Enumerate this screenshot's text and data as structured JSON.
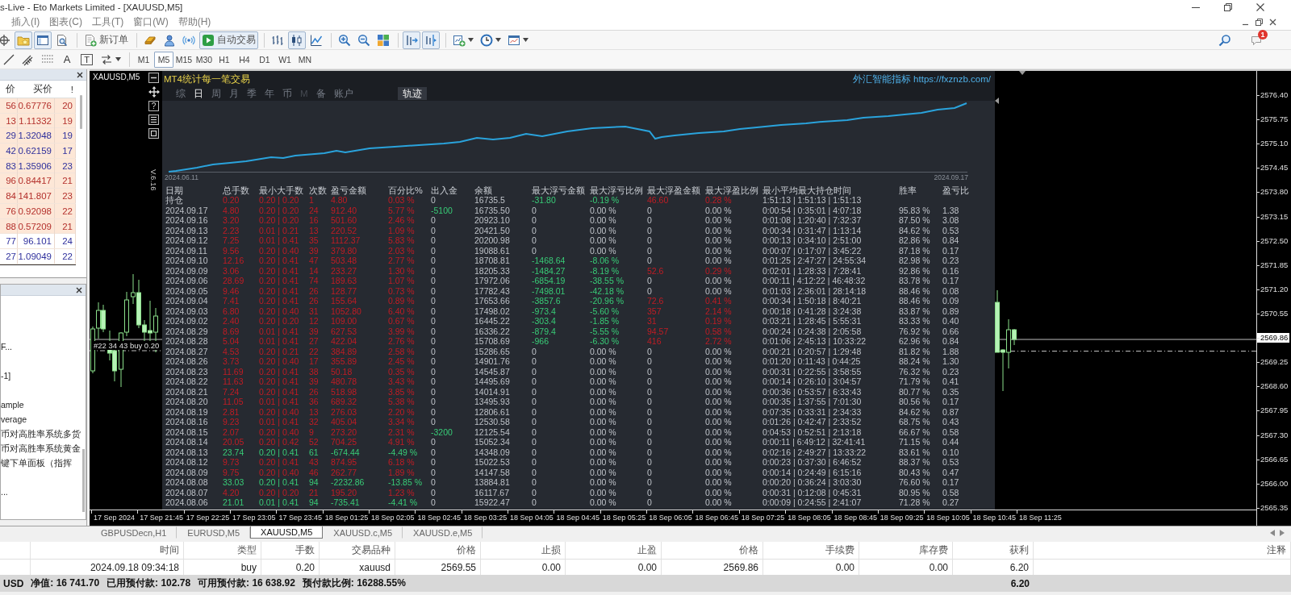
{
  "window": {
    "title": "s-Live - Eto Markets Limited - [XAUUSD,M5]"
  },
  "menu": [
    "插入(I)",
    "图表(C)",
    "工具(T)",
    "窗口(W)",
    "帮助(H)"
  ],
  "toolbar": {
    "panel_toggles": [
      {
        "on": true
      },
      {
        "on": true
      },
      {
        "on": false
      }
    ],
    "new_order": "新订单",
    "auto_trading": {
      "label": "自动交易",
      "on": true
    },
    "chart_types": [
      {
        "selected": false
      },
      {
        "selected": true
      },
      {
        "selected": false
      }
    ],
    "auto_scroll": {
      "on": true
    },
    "chart_shift": {
      "on": true
    },
    "notification_badge": "1"
  },
  "drawing_toolbar": {
    "text_tool": "A",
    "text_label_tool": "T",
    "timeframes": [
      {
        "label": "M1",
        "selected": false
      },
      {
        "label": "M5",
        "selected": true
      },
      {
        "label": "M15",
        "selected": false
      },
      {
        "label": "M30",
        "selected": false
      },
      {
        "label": "H1",
        "selected": false
      },
      {
        "label": "H4",
        "selected": false
      },
      {
        "label": "D1",
        "selected": false
      },
      {
        "label": "W1",
        "selected": false
      },
      {
        "label": "MN",
        "selected": false
      }
    ]
  },
  "market_watch": {
    "columns": [
      "价",
      "买价",
      "!"
    ],
    "rows": [
      {
        "column_1": "56",
        "ask": "0.67776",
        "column_3": "20",
        "rising": false,
        "highlighted": true
      },
      {
        "column_1": "13",
        "ask": "1.11332",
        "column_3": "19",
        "rising": false,
        "highlighted": true
      },
      {
        "column_1": "29",
        "ask": "1.32048",
        "column_3": "19",
        "rising": true,
        "highlighted": true
      },
      {
        "column_1": "42",
        "ask": "0.62159",
        "column_3": "17",
        "rising": true,
        "highlighted": true
      },
      {
        "column_1": "83",
        "ask": "1.35906",
        "column_3": "23",
        "rising": true,
        "highlighted": true
      },
      {
        "column_1": "96",
        "ask": "0.84417",
        "column_3": "21",
        "rising": false,
        "highlighted": true
      },
      {
        "column_1": "84",
        "ask": "141.807",
        "column_3": "23",
        "rising": false,
        "highlighted": true
      },
      {
        "column_1": "76",
        "ask": "0.92098",
        "column_3": "22",
        "rising": false,
        "highlighted": true
      },
      {
        "column_1": "88",
        "ask": "0.57209",
        "column_3": "21",
        "rising": false,
        "highlighted": true
      },
      {
        "column_1": "77",
        "ask": "96.101",
        "column_3": "24",
        "rising": true,
        "highlighted": false
      },
      {
        "column_1": "27",
        "ask": "1.09049",
        "column_3": "22",
        "rising": true,
        "highlighted": false
      }
    ]
  },
  "navigator": {
    "items": [
      "F...",
      "-1]",
      "ample",
      "verage",
      "币对高胜率系统多货",
      "币对高胜率系统黄金",
      "键下单面板（指挥",
      "..."
    ]
  },
  "chart": {
    "symbol": "XAUUSD,M5",
    "help_button": "?",
    "version": "V.6.16",
    "order_label": "#22 34 43 buy 0.20",
    "price_axis": [
      {
        "label": "2576.40",
        "kind": "tick"
      },
      {
        "label": "2575.75",
        "kind": "tick"
      },
      {
        "label": "2575.10",
        "kind": "tick"
      },
      {
        "label": "2574.45",
        "kind": "tick"
      },
      {
        "label": "2573.80",
        "kind": "tick"
      },
      {
        "label": "2573.15",
        "kind": "tick"
      },
      {
        "label": "2572.50",
        "kind": "tick"
      },
      {
        "label": "2571.85",
        "kind": "tick"
      },
      {
        "label": "2571.20",
        "kind": "tick"
      },
      {
        "label": "2570.55",
        "kind": "tick"
      },
      {
        "label": "2569.86",
        "kind": "current"
      },
      {
        "label": "2569.25",
        "kind": "tick"
      },
      {
        "label": "2568.60",
        "kind": "tick"
      },
      {
        "label": "2567.95",
        "kind": "tick"
      },
      {
        "label": "2567.30",
        "kind": "tick"
      },
      {
        "label": "2566.65",
        "kind": "tick"
      },
      {
        "label": "2566.00",
        "kind": "tick"
      },
      {
        "label": "2565.35",
        "kind": "tick"
      }
    ],
    "time_axis": [
      "17 Sep 2024",
      "17 Sep 21:45",
      "17 Sep 22:25",
      "17 Sep 23:05",
      "17 Sep 23:45",
      "18 Sep 01:25",
      "18 Sep 02:05",
      "18 Sep 02:45",
      "18 Sep 03:25",
      "18 Sep 04:05",
      "18 Sep 04:45",
      "18 Sep 05:25",
      "18 Sep 06:05",
      "18 Sep 06:45",
      "18 Sep 07:25",
      "18 Sep 08:05",
      "18 Sep 08:45",
      "18 Sep 09:25",
      "18 Sep 10:05",
      "18 Sep 10:45",
      "18 Sep 11:25"
    ]
  },
  "indicator": {
    "title": "MT4统计每一笔交易",
    "link": "外汇智能指标 https://fxznzb.com/",
    "tabs": [
      {
        "label": "综",
        "selected": false,
        "disabled": false
      },
      {
        "label": "日",
        "selected": true,
        "disabled": false
      },
      {
        "label": "周",
        "selected": false,
        "disabled": false
      },
      {
        "label": "月",
        "selected": false,
        "disabled": false
      },
      {
        "label": "季",
        "selected": false,
        "disabled": false
      },
      {
        "label": "年",
        "selected": false,
        "disabled": false
      },
      {
        "label": "币",
        "selected": false,
        "disabled": false
      },
      {
        "label": "M",
        "selected": false,
        "disabled": true
      },
      {
        "label": "备",
        "selected": false,
        "disabled": false
      },
      {
        "label": "账户",
        "selected": false,
        "disabled": false
      }
    ],
    "track_toggle": {
      "label": "轨迹",
      "on": true
    },
    "equity_curve": {
      "start_date": "2024.06.11",
      "end_date": "2024.09.17"
    },
    "table": {
      "columns": [
        "日期",
        "总手数",
        "最小大手数",
        "次数",
        "盈亏金额",
        "百分比%",
        "出入金",
        "余额",
        "最大浮亏金额",
        "最大浮亏比例",
        "最大浮盈金额",
        "最大浮盈比例",
        "最小平均最大持仓时间",
        "胜率",
        "盈亏比"
      ],
      "rows": [
        {
          "date": "持仓",
          "total_lots": "0.20",
          "min_max_lots": "0.20 | 0.20",
          "trades": "1",
          "profit": "4.80",
          "percent": "0.03 %",
          "deposit": "0",
          "balance": "16735.5",
          "max_float_loss": "-31.80",
          "max_float_loss_pct": "-0.19 %",
          "max_float_profit": "46.60",
          "max_float_profit_pct": "0.28 %",
          "hold_time": "1:51:13 | 1:51:13 | 1:51:13",
          "loss": false,
          "withdrawal": false,
          "floating_loss": true,
          "floating_profit": true
        },
        {
          "date": "2024.09.17",
          "total_lots": "4.80",
          "min_max_lots": "0.20 | 0.20",
          "trades": "24",
          "profit": "912.40",
          "percent": "5.77 %",
          "deposit": "-5100",
          "balance": "16735.50",
          "max_float_loss": "0",
          "max_float_loss_pct": "0.00 %",
          "max_float_profit": "0",
          "max_float_profit_pct": "0.00 %",
          "hold_time": "0:00:54 | 0:35:01 | 4:07:18",
          "win_rate": "95.83 %",
          "profit_ratio": "1.38",
          "loss": false,
          "withdrawal": true,
          "floating_loss": false,
          "floating_profit": false
        },
        {
          "date": "2024.09.16",
          "total_lots": "3.20",
          "min_max_lots": "0.20 | 0.20",
          "trades": "16",
          "profit": "501.60",
          "percent": "2.46 %",
          "deposit": "0",
          "balance": "20923.10",
          "max_float_loss": "0",
          "max_float_loss_pct": "0.00 %",
          "max_float_profit": "0",
          "max_float_profit_pct": "0.00 %",
          "hold_time": "0:01:08 | 1:20:40 | 7:32:37",
          "win_rate": "87.50 %",
          "profit_ratio": "3.08",
          "loss": false,
          "withdrawal": false,
          "floating_loss": false,
          "floating_profit": false
        },
        {
          "date": "2024.09.13",
          "total_lots": "2.23",
          "min_max_lots": "0.01 | 0.21",
          "trades": "13",
          "profit": "220.52",
          "percent": "1.09 %",
          "deposit": "0",
          "balance": "20421.50",
          "max_float_loss": "0",
          "max_float_loss_pct": "0.00 %",
          "max_float_profit": "0",
          "max_float_profit_pct": "0.00 %",
          "hold_time": "0:00:34 | 0:31:47 | 1:13:14",
          "win_rate": "84.62 %",
          "profit_ratio": "0.53",
          "loss": false,
          "withdrawal": false,
          "floating_loss": false,
          "floating_profit": false
        },
        {
          "date": "2024.09.12",
          "total_lots": "7.25",
          "min_max_lots": "0.01 | 0.41",
          "trades": "35",
          "profit": "1112.37",
          "percent": "5.83 %",
          "deposit": "0",
          "balance": "20200.98",
          "max_float_loss": "0",
          "max_float_loss_pct": "0.00 %",
          "max_float_profit": "0",
          "max_float_profit_pct": "0.00 %",
          "hold_time": "0:00:13 | 0:34:10 | 2:51:00",
          "win_rate": "82.86 %",
          "profit_ratio": "0.84",
          "loss": false,
          "withdrawal": false,
          "floating_loss": false,
          "floating_profit": false
        },
        {
          "date": "2024.09.11",
          "total_lots": "9.56",
          "min_max_lots": "0.20 | 0.40",
          "trades": "39",
          "profit": "379.80",
          "percent": "2.03 %",
          "deposit": "0",
          "balance": "19088.61",
          "max_float_loss": "0",
          "max_float_loss_pct": "0.00 %",
          "max_float_profit": "0",
          "max_float_profit_pct": "0.00 %",
          "hold_time": "0:00:07 | 0:17:07 | 3:45:22",
          "win_rate": "87.18 %",
          "profit_ratio": "0.17",
          "loss": false,
          "withdrawal": false,
          "floating_loss": false,
          "floating_profit": false
        },
        {
          "date": "2024.09.10",
          "total_lots": "12.16",
          "min_max_lots": "0.20 | 0.41",
          "trades": "47",
          "profit": "503.48",
          "percent": "2.77 %",
          "deposit": "0",
          "balance": "18708.81",
          "max_float_loss": "-1468.64",
          "max_float_loss_pct": "-8.06 %",
          "max_float_profit": "0",
          "max_float_profit_pct": "0.00 %",
          "hold_time": "0:01:25 | 2:47:27 | 24:55:34",
          "win_rate": "82.98 %",
          "profit_ratio": "0.23",
          "loss": false,
          "withdrawal": false,
          "floating_loss": true,
          "floating_profit": false
        },
        {
          "date": "2024.09.09",
          "total_lots": "3.06",
          "min_max_lots": "0.20 | 0.41",
          "trades": "14",
          "profit": "233.27",
          "percent": "1.30 %",
          "deposit": "0",
          "balance": "18205.33",
          "max_float_loss": "-1484.27",
          "max_float_loss_pct": "-8.19 %",
          "max_float_profit": "52.6",
          "max_float_profit_pct": "0.29 %",
          "hold_time": "0:02:01 | 1:28:33 | 7:28:41",
          "win_rate": "92.86 %",
          "profit_ratio": "0.16",
          "loss": false,
          "withdrawal": false,
          "floating_loss": true,
          "floating_profit": true
        },
        {
          "date": "2024.09.06",
          "total_lots": "28.69",
          "min_max_lots": "0.20 | 0.41",
          "trades": "74",
          "profit": "189.63",
          "percent": "1.07 %",
          "deposit": "0",
          "balance": "17972.06",
          "max_float_loss": "-6854.19",
          "max_float_loss_pct": "-38.55 %",
          "max_float_profit": "0",
          "max_float_profit_pct": "0.00 %",
          "hold_time": "0:00:11 | 4:12:22 | 46:48:32",
          "win_rate": "83.78 %",
          "profit_ratio": "0.17",
          "loss": false,
          "withdrawal": false,
          "floating_loss": true,
          "floating_profit": false
        },
        {
          "date": "2024.09.05",
          "total_lots": "9.46",
          "min_max_lots": "0.20 | 0.41",
          "trades": "26",
          "profit": "128.77",
          "percent": "0.73 %",
          "deposit": "0",
          "balance": "17782.43",
          "max_float_loss": "-7498.01",
          "max_float_loss_pct": "-42.18 %",
          "max_float_profit": "0",
          "max_float_profit_pct": "0.00 %",
          "hold_time": "0:01:03 | 2:36:01 | 28:14:18",
          "win_rate": "88.46 %",
          "profit_ratio": "0.08",
          "loss": false,
          "withdrawal": false,
          "floating_loss": true,
          "floating_profit": false
        },
        {
          "date": "2024.09.04",
          "total_lots": "7.41",
          "min_max_lots": "0.20 | 0.41",
          "trades": "26",
          "profit": "155.64",
          "percent": "0.89 %",
          "deposit": "0",
          "balance": "17653.66",
          "max_float_loss": "-3857.6",
          "max_float_loss_pct": "-20.96 %",
          "max_float_profit": "72.6",
          "max_float_profit_pct": "0.41 %",
          "hold_time": "0:00:34 | 1:50:18 | 8:40:21",
          "win_rate": "88.46 %",
          "profit_ratio": "0.09",
          "loss": false,
          "withdrawal": false,
          "floating_loss": true,
          "floating_profit": true
        },
        {
          "date": "2024.09.03",
          "total_lots": "6.80",
          "min_max_lots": "0.20 | 0.40",
          "trades": "31",
          "profit": "1052.80",
          "percent": "6.40 %",
          "deposit": "0",
          "balance": "17498.02",
          "max_float_loss": "-973.4",
          "max_float_loss_pct": "-5.60 %",
          "max_float_profit": "357",
          "max_float_profit_pct": "2.14 %",
          "hold_time": "0:00:18 | 0:41:28 | 3:24:38",
          "win_rate": "83.87 %",
          "profit_ratio": "0.89",
          "loss": false,
          "withdrawal": false,
          "floating_loss": true,
          "floating_profit": true
        },
        {
          "date": "2024.09.02",
          "total_lots": "2.40",
          "min_max_lots": "0.20 | 0.20",
          "trades": "12",
          "profit": "109.00",
          "percent": "0.67 %",
          "deposit": "0",
          "balance": "16445.22",
          "max_float_loss": "-303.4",
          "max_float_loss_pct": "-1.85 %",
          "max_float_profit": "31",
          "max_float_profit_pct": "0.19 %",
          "hold_time": "0:03:21 | 1:28:45 | 5:55:31",
          "win_rate": "83.33 %",
          "profit_ratio": "0.40",
          "loss": false,
          "withdrawal": false,
          "floating_loss": true,
          "floating_profit": true
        },
        {
          "date": "2024.08.29",
          "total_lots": "8.69",
          "min_max_lots": "0.01 | 0.41",
          "trades": "39",
          "profit": "627.53",
          "percent": "3.99 %",
          "deposit": "0",
          "balance": "16336.22",
          "max_float_loss": "-879.4",
          "max_float_loss_pct": "-5.55 %",
          "max_float_profit": "94.57",
          "max_float_profit_pct": "0.58 %",
          "hold_time": "0:00:24 | 0:24:38 | 2:05:58",
          "win_rate": "76.92 %",
          "profit_ratio": "0.66",
          "loss": false,
          "withdrawal": false,
          "floating_loss": true,
          "floating_profit": true
        },
        {
          "date": "2024.08.28",
          "total_lots": "5.04",
          "min_max_lots": "0.01 | 0.41",
          "trades": "27",
          "profit": "422.04",
          "percent": "2.76 %",
          "deposit": "0",
          "balance": "15708.69",
          "max_float_loss": "-966",
          "max_float_loss_pct": "-6.30 %",
          "max_float_profit": "416",
          "max_float_profit_pct": "2.72 %",
          "hold_time": "0:01:06 | 2:45:13 | 10:33:22",
          "win_rate": "62.96 %",
          "profit_ratio": "0.84",
          "loss": false,
          "withdrawal": false,
          "floating_loss": true,
          "floating_profit": true
        },
        {
          "date": "2024.08.27",
          "total_lots": "4.53",
          "min_max_lots": "0.20 | 0.21",
          "trades": "22",
          "profit": "384.89",
          "percent": "2.58 %",
          "deposit": "0",
          "balance": "15286.65",
          "max_float_loss": "0",
          "max_float_loss_pct": "0.00 %",
          "max_float_profit": "0",
          "max_float_profit_pct": "0.00 %",
          "hold_time": "0:00:21 | 0:20:57 | 1:29:48",
          "win_rate": "81.82 %",
          "profit_ratio": "1.88",
          "loss": false,
          "withdrawal": false,
          "floating_loss": false,
          "floating_profit": false
        },
        {
          "date": "2024.08.26",
          "total_lots": "3.73",
          "min_max_lots": "0.20 | 0.40",
          "trades": "17",
          "profit": "355.89",
          "percent": "2.45 %",
          "deposit": "0",
          "balance": "14901.76",
          "max_float_loss": "0",
          "max_float_loss_pct": "0.00 %",
          "max_float_profit": "0",
          "max_float_profit_pct": "0.00 %",
          "hold_time": "0:01:20 | 0:11:43 | 0:44:25",
          "win_rate": "88.24 %",
          "profit_ratio": "1.30",
          "loss": false,
          "withdrawal": false,
          "floating_loss": false,
          "floating_profit": false
        },
        {
          "date": "2024.08.23",
          "total_lots": "11.69",
          "min_max_lots": "0.20 | 0.41",
          "trades": "38",
          "profit": "50.18",
          "percent": "0.35 %",
          "deposit": "0",
          "balance": "14545.87",
          "max_float_loss": "0",
          "max_float_loss_pct": "0.00 %",
          "max_float_profit": "0",
          "max_float_profit_pct": "0.00 %",
          "hold_time": "0:00:31 | 0:22:55 | 3:58:55",
          "win_rate": "76.32 %",
          "profit_ratio": "0.23",
          "loss": false,
          "withdrawal": false,
          "floating_loss": false,
          "floating_profit": false
        },
        {
          "date": "2024.08.22",
          "total_lots": "11.63",
          "min_max_lots": "0.20 | 0.41",
          "trades": "39",
          "profit": "480.78",
          "percent": "3.43 %",
          "deposit": "0",
          "balance": "14495.69",
          "max_float_loss": "0",
          "max_float_loss_pct": "0.00 %",
          "max_float_profit": "0",
          "max_float_profit_pct": "0.00 %",
          "hold_time": "0:00:14 | 0:26:10 | 3:04:57",
          "win_rate": "71.79 %",
          "profit_ratio": "0.41",
          "loss": false,
          "withdrawal": false,
          "floating_loss": false,
          "floating_profit": false
        },
        {
          "date": "2024.08.21",
          "total_lots": "7.24",
          "min_max_lots": "0.20 | 0.41",
          "trades": "26",
          "profit": "518.98",
          "percent": "3.85 %",
          "deposit": "0",
          "balance": "14014.91",
          "max_float_loss": "0",
          "max_float_loss_pct": "0.00 %",
          "max_float_profit": "0",
          "max_float_profit_pct": "0.00 %",
          "hold_time": "0:00:36 | 0:53:57 | 6:33:43",
          "win_rate": "80.77 %",
          "profit_ratio": "0.35",
          "loss": false,
          "withdrawal": false,
          "floating_loss": false,
          "floating_profit": false
        },
        {
          "date": "2024.08.20",
          "total_lots": "11.05",
          "min_max_lots": "0.01 | 0.41",
          "trades": "36",
          "profit": "689.32",
          "percent": "5.38 %",
          "deposit": "0",
          "balance": "13495.93",
          "max_float_loss": "0",
          "max_float_loss_pct": "0.00 %",
          "max_float_profit": "0",
          "max_float_profit_pct": "0.00 %",
          "hold_time": "0:00:35 | 1:37:55 | 7:01:30",
          "win_rate": "80.56 %",
          "profit_ratio": "0.17",
          "loss": false,
          "withdrawal": false,
          "floating_loss": false,
          "floating_profit": false
        },
        {
          "date": "2024.08.19",
          "total_lots": "2.81",
          "min_max_lots": "0.20 | 0.40",
          "trades": "13",
          "profit": "276.03",
          "percent": "2.20 %",
          "deposit": "0",
          "balance": "12806.61",
          "max_float_loss": "0",
          "max_float_loss_pct": "0.00 %",
          "max_float_profit": "0",
          "max_float_profit_pct": "0.00 %",
          "hold_time": "0:07:35 | 0:33:31 | 2:34:33",
          "win_rate": "84.62 %",
          "profit_ratio": "0.87",
          "loss": false,
          "withdrawal": false,
          "floating_loss": false,
          "floating_profit": false
        },
        {
          "date": "2024.08.16",
          "total_lots": "9.23",
          "min_max_lots": "0.01 | 0.41",
          "trades": "32",
          "profit": "405.04",
          "percent": "3.34 %",
          "deposit": "0",
          "balance": "12530.58",
          "max_float_loss": "0",
          "max_float_loss_pct": "0.00 %",
          "max_float_profit": "0",
          "max_float_profit_pct": "0.00 %",
          "hold_time": "0:01:26 | 0:42:47 | 2:33:52",
          "win_rate": "68.75 %",
          "profit_ratio": "0.43",
          "loss": false,
          "withdrawal": false,
          "floating_loss": false,
          "floating_profit": false
        },
        {
          "date": "2024.08.15",
          "total_lots": "2.07",
          "min_max_lots": "0.20 | 0.40",
          "trades": "9",
          "profit": "273.20",
          "percent": "2.31 %",
          "deposit": "-3200",
          "balance": "12125.54",
          "max_float_loss": "0",
          "max_float_loss_pct": "0.00 %",
          "max_float_profit": "0",
          "max_float_profit_pct": "0.00 %",
          "hold_time": "0:04:53 | 0:52:51 | 2:13:18",
          "win_rate": "66.67 %",
          "profit_ratio": "0.58",
          "loss": false,
          "withdrawal": true,
          "floating_loss": false,
          "floating_profit": false
        },
        {
          "date": "2024.08.14",
          "total_lots": "20.05",
          "min_max_lots": "0.20 | 0.42",
          "trades": "52",
          "profit": "704.25",
          "percent": "4.91 %",
          "deposit": "0",
          "balance": "15052.34",
          "max_float_loss": "0",
          "max_float_loss_pct": "0.00 %",
          "max_float_profit": "0",
          "max_float_profit_pct": "0.00 %",
          "hold_time": "0:00:11 | 6:49:12 | 32:41:41",
          "win_rate": "71.15 %",
          "profit_ratio": "0.44",
          "loss": false,
          "withdrawal": false,
          "floating_loss": false,
          "floating_profit": false
        },
        {
          "date": "2024.08.13",
          "total_lots": "23.74",
          "min_max_lots": "0.20 | 0.41",
          "trades": "61",
          "profit": "-674.44",
          "percent": "-4.49 %",
          "deposit": "0",
          "balance": "14348.09",
          "max_float_loss": "0",
          "max_float_loss_pct": "0.00 %",
          "max_float_profit": "0",
          "max_float_profit_pct": "0.00 %",
          "hold_time": "0:02:16 | 2:49:27 | 13:33:22",
          "win_rate": "83.61 %",
          "profit_ratio": "0.10",
          "loss": true,
          "withdrawal": false,
          "floating_loss": false,
          "floating_profit": false
        },
        {
          "date": "2024.08.12",
          "total_lots": "9.73",
          "min_max_lots": "0.20 | 0.41",
          "trades": "43",
          "profit": "874.95",
          "percent": "6.18 %",
          "deposit": "0",
          "balance": "15022.53",
          "max_float_loss": "0",
          "max_float_loss_pct": "0.00 %",
          "max_float_profit": "0",
          "max_float_profit_pct": "0.00 %",
          "hold_time": "0:00:23 | 0:37:30 | 6:46:52",
          "win_rate": "88.37 %",
          "profit_ratio": "0.53",
          "loss": false,
          "withdrawal": false,
          "floating_loss": false,
          "floating_profit": false
        },
        {
          "date": "2024.08.09",
          "total_lots": "9.75",
          "min_max_lots": "0.20 | 0.40",
          "trades": "46",
          "profit": "262.77",
          "percent": "1.89 %",
          "deposit": "0",
          "balance": "14147.58",
          "max_float_loss": "0",
          "max_float_loss_pct": "0.00 %",
          "max_float_profit": "0",
          "max_float_profit_pct": "0.00 %",
          "hold_time": "0:00:14 | 0:24:49 | 6:15:16",
          "win_rate": "80.43 %",
          "profit_ratio": "0.47",
          "loss": false,
          "withdrawal": false,
          "floating_loss": false,
          "floating_profit": false
        },
        {
          "date": "2024.08.08",
          "total_lots": "33.03",
          "min_max_lots": "0.20 | 0.41",
          "trades": "94",
          "profit": "-2232.86",
          "percent": "-13.85 %",
          "deposit": "0",
          "balance": "13884.81",
          "max_float_loss": "0",
          "max_float_loss_pct": "0.00 %",
          "max_float_profit": "0",
          "max_float_profit_pct": "0.00 %",
          "hold_time": "0:00:20 | 0:36:24 | 3:03:30",
          "win_rate": "76.60 %",
          "profit_ratio": "0.17",
          "loss": true,
          "withdrawal": false,
          "floating_loss": false,
          "floating_profit": false
        },
        {
          "date": "2024.08.07",
          "total_lots": "4.20",
          "min_max_lots": "0.20 | 0.20",
          "trades": "21",
          "profit": "195.20",
          "percent": "1.23 %",
          "deposit": "0",
          "balance": "16117.67",
          "max_float_loss": "0",
          "max_float_loss_pct": "0.00 %",
          "max_float_profit": "0",
          "max_float_profit_pct": "0.00 %",
          "hold_time": "0:00:31 | 0:12:08 | 0:45:31",
          "win_rate": "80.95 %",
          "profit_ratio": "0.58",
          "loss": false,
          "withdrawal": false,
          "floating_loss": false,
          "floating_profit": false
        },
        {
          "date": "2024.08.06",
          "total_lots": "21.01",
          "min_max_lots": "0.01 | 0.41",
          "trades": "94",
          "profit": "-735.41",
          "percent": "-4.41 %",
          "deposit": "0",
          "balance": "15922.47",
          "max_float_loss": "0",
          "max_float_loss_pct": "0.00 %",
          "max_float_profit": "0",
          "max_float_profit_pct": "0.00 %",
          "hold_time": "0:00:09 | 0:24:55 | 2:41:07",
          "win_rate": "71.28 %",
          "profit_ratio": "0.27",
          "loss": true,
          "withdrawal": false,
          "floating_loss": false,
          "floating_profit": false
        }
      ]
    }
  },
  "chart_tabs": [
    {
      "label": "GBPUSDecn,H1",
      "selected": false
    },
    {
      "label": "EURUSD,M5",
      "selected": false
    },
    {
      "label": "XAUUSD,M5",
      "selected": true
    },
    {
      "label": "XAUUSD.c,M5",
      "selected": false
    },
    {
      "label": "XAUUSD.e,M5",
      "selected": false
    }
  ],
  "terminal": {
    "columns": [
      "时间",
      "类型",
      "手数",
      "交易品种",
      "价格",
      "止损",
      "止盈",
      "价格",
      "手续费",
      "库存费",
      "获利",
      "注释"
    ],
    "rows": [
      {
        "time": "2024.09.18 09:34:18",
        "type": "buy",
        "lots": "0.20",
        "symbol": "xauusd",
        "open_price": "2569.55",
        "stop_loss": "0.00",
        "take_profit": "0.00",
        "current_price": "2569.86",
        "commission": "0.00",
        "swap": "0.00",
        "profit": "6.20"
      }
    ],
    "summary": {
      "items": [
        "USD",
        "净值: 16 741.70",
        "已用预付款: 102.78",
        "可用预付款: 16 638.92",
        "预付款比例: 16288.55%"
      ],
      "total_profit": "6.20"
    }
  }
}
